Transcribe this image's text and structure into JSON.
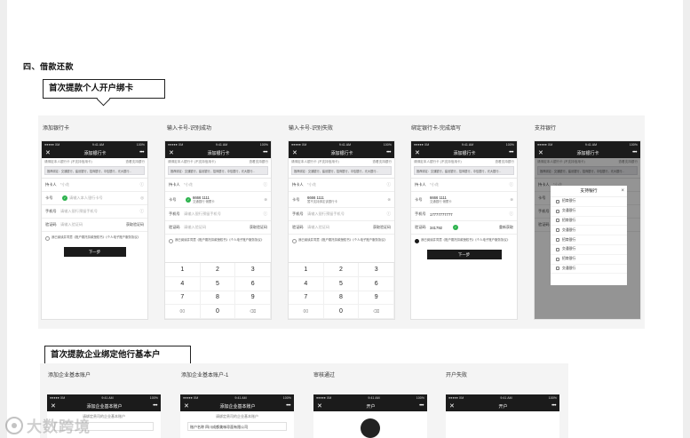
{
  "section_title": "四、借款还款",
  "callouts": {
    "first": "首次提款个人开户绑卡",
    "second": "首次提款企业绑定他行基本户"
  },
  "row1": {
    "columns": [
      "添加银行卡",
      "输入卡号-识别成功",
      "输入卡号-识别失败",
      "绑定银行卡-完成填写",
      "支持银行"
    ],
    "statusbar": {
      "carrier": "●●●●● XM",
      "time": "9:41 AM",
      "battery": "100%"
    },
    "nav_title": "添加银行卡",
    "hint_left": "请绑定本人银行卡 (不支持信用卡)",
    "hint_right": "查看支持银行",
    "banks_strip": "推荐绑定：交通银行，建设银行，招商银行，中信银行，光大银行...",
    "holder_label": "持卡人",
    "holder_value": "*小花",
    "card_label": "卡号",
    "card_placeholder": "请输入本人银行卡号",
    "card_number": "6666 1111",
    "card_bank_ok": "交通银行 储蓄卡",
    "card_bank_fail": "暂不支持绑定该银行卡",
    "phone_label": "手机号",
    "phone_placeholder": "请输入银行预留手机号",
    "phone_value": "17777777777",
    "code_label": "验证码",
    "code_placeholder": "请输入验证码",
    "code_value": "341792",
    "code_action": "获取验证码",
    "code_resend": "重新获取",
    "agree_text": "我已阅读并同意《账户委托扣款授权书》《个人电子账户服务协议》",
    "next_button": "下一步",
    "keypad": [
      "1",
      "2",
      "3",
      "4",
      "5",
      "6",
      "7",
      "8",
      "9",
      "00",
      "0",
      "⌫"
    ],
    "support_title": "支持银行",
    "support_banks": [
      "招商银行",
      "交通银行",
      "招商银行",
      "交通银行",
      "招商银行",
      "交通银行",
      "招商银行",
      "交通银行"
    ]
  },
  "row2": {
    "columns": [
      "添加企业基本账户",
      "添加企业基本账户-1",
      "审核通过",
      "开户失败"
    ],
    "nav_titles": [
      "添加企业基本账户",
      "添加企业基本账户",
      "开户",
      "开户"
    ],
    "hint": "请绑定贵司的企业基本账户",
    "field_preview": "账户名称  四川成都美味珍面有限公司"
  },
  "watermark": "大数跨境"
}
